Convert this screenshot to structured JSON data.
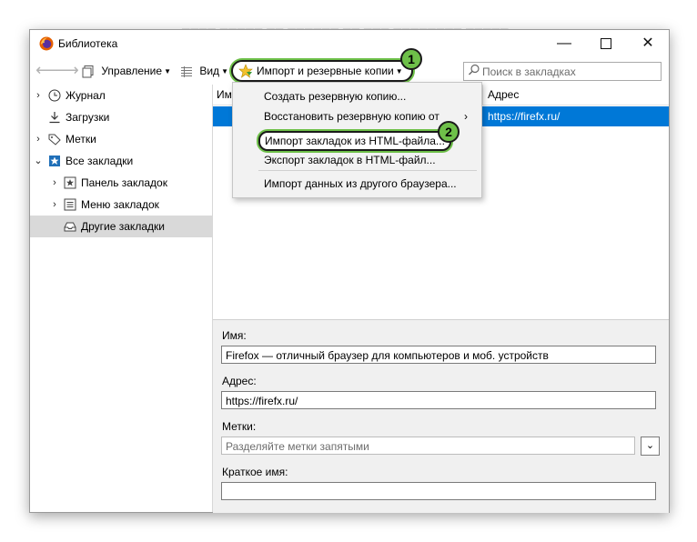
{
  "window": {
    "title": "Библиотека",
    "minimize_glyph": "—",
    "close_glyph": "✕"
  },
  "toolbar": {
    "manage_label": "Управление",
    "view_label": "Вид",
    "import_label": "Импорт и резервные копии",
    "search_placeholder": "Поиск в закладках"
  },
  "badges": {
    "first": "1",
    "second": "2"
  },
  "sidebar": {
    "items": [
      {
        "label": "Журнал",
        "icon": "clock-icon"
      },
      {
        "label": "Загрузки",
        "icon": "download-icon"
      },
      {
        "label": "Метки",
        "icon": "tag-icon"
      },
      {
        "label": "Все закладки",
        "icon": "star-folder-icon"
      },
      {
        "label": "Панель закладок",
        "icon": "star-toolbar-icon"
      },
      {
        "label": "Меню закладок",
        "icon": "menu-list-icon"
      },
      {
        "label": "Другие закладки",
        "icon": "tray-icon"
      }
    ]
  },
  "list": {
    "col_name": "Им",
    "col_address": "Адрес",
    "rows": [
      {
        "address": "https://firefx.ru/"
      }
    ]
  },
  "menu": {
    "items": [
      "Создать резервную копию...",
      "Восстановить резервную копию от",
      "Импорт закладок из HTML-файла...",
      "Экспорт закладок в HTML-файл...",
      "Импорт данных из другого браузера..."
    ],
    "submenu_arrow": "›"
  },
  "details": {
    "name_label": "Имя:",
    "name_value": "Firefox — отличный браузер для компьютеров и моб. устройств",
    "address_label": "Адрес:",
    "address_value": "https://firefx.ru/",
    "tags_label": "Метки:",
    "tags_placeholder": "Разделяйте метки запятыми",
    "keyword_label": "Краткое имя:",
    "keyword_value": ""
  },
  "colors": {
    "selection": "#0078d7",
    "highlight_green": "#6ec049",
    "details_bg": "#f0f0f0"
  }
}
